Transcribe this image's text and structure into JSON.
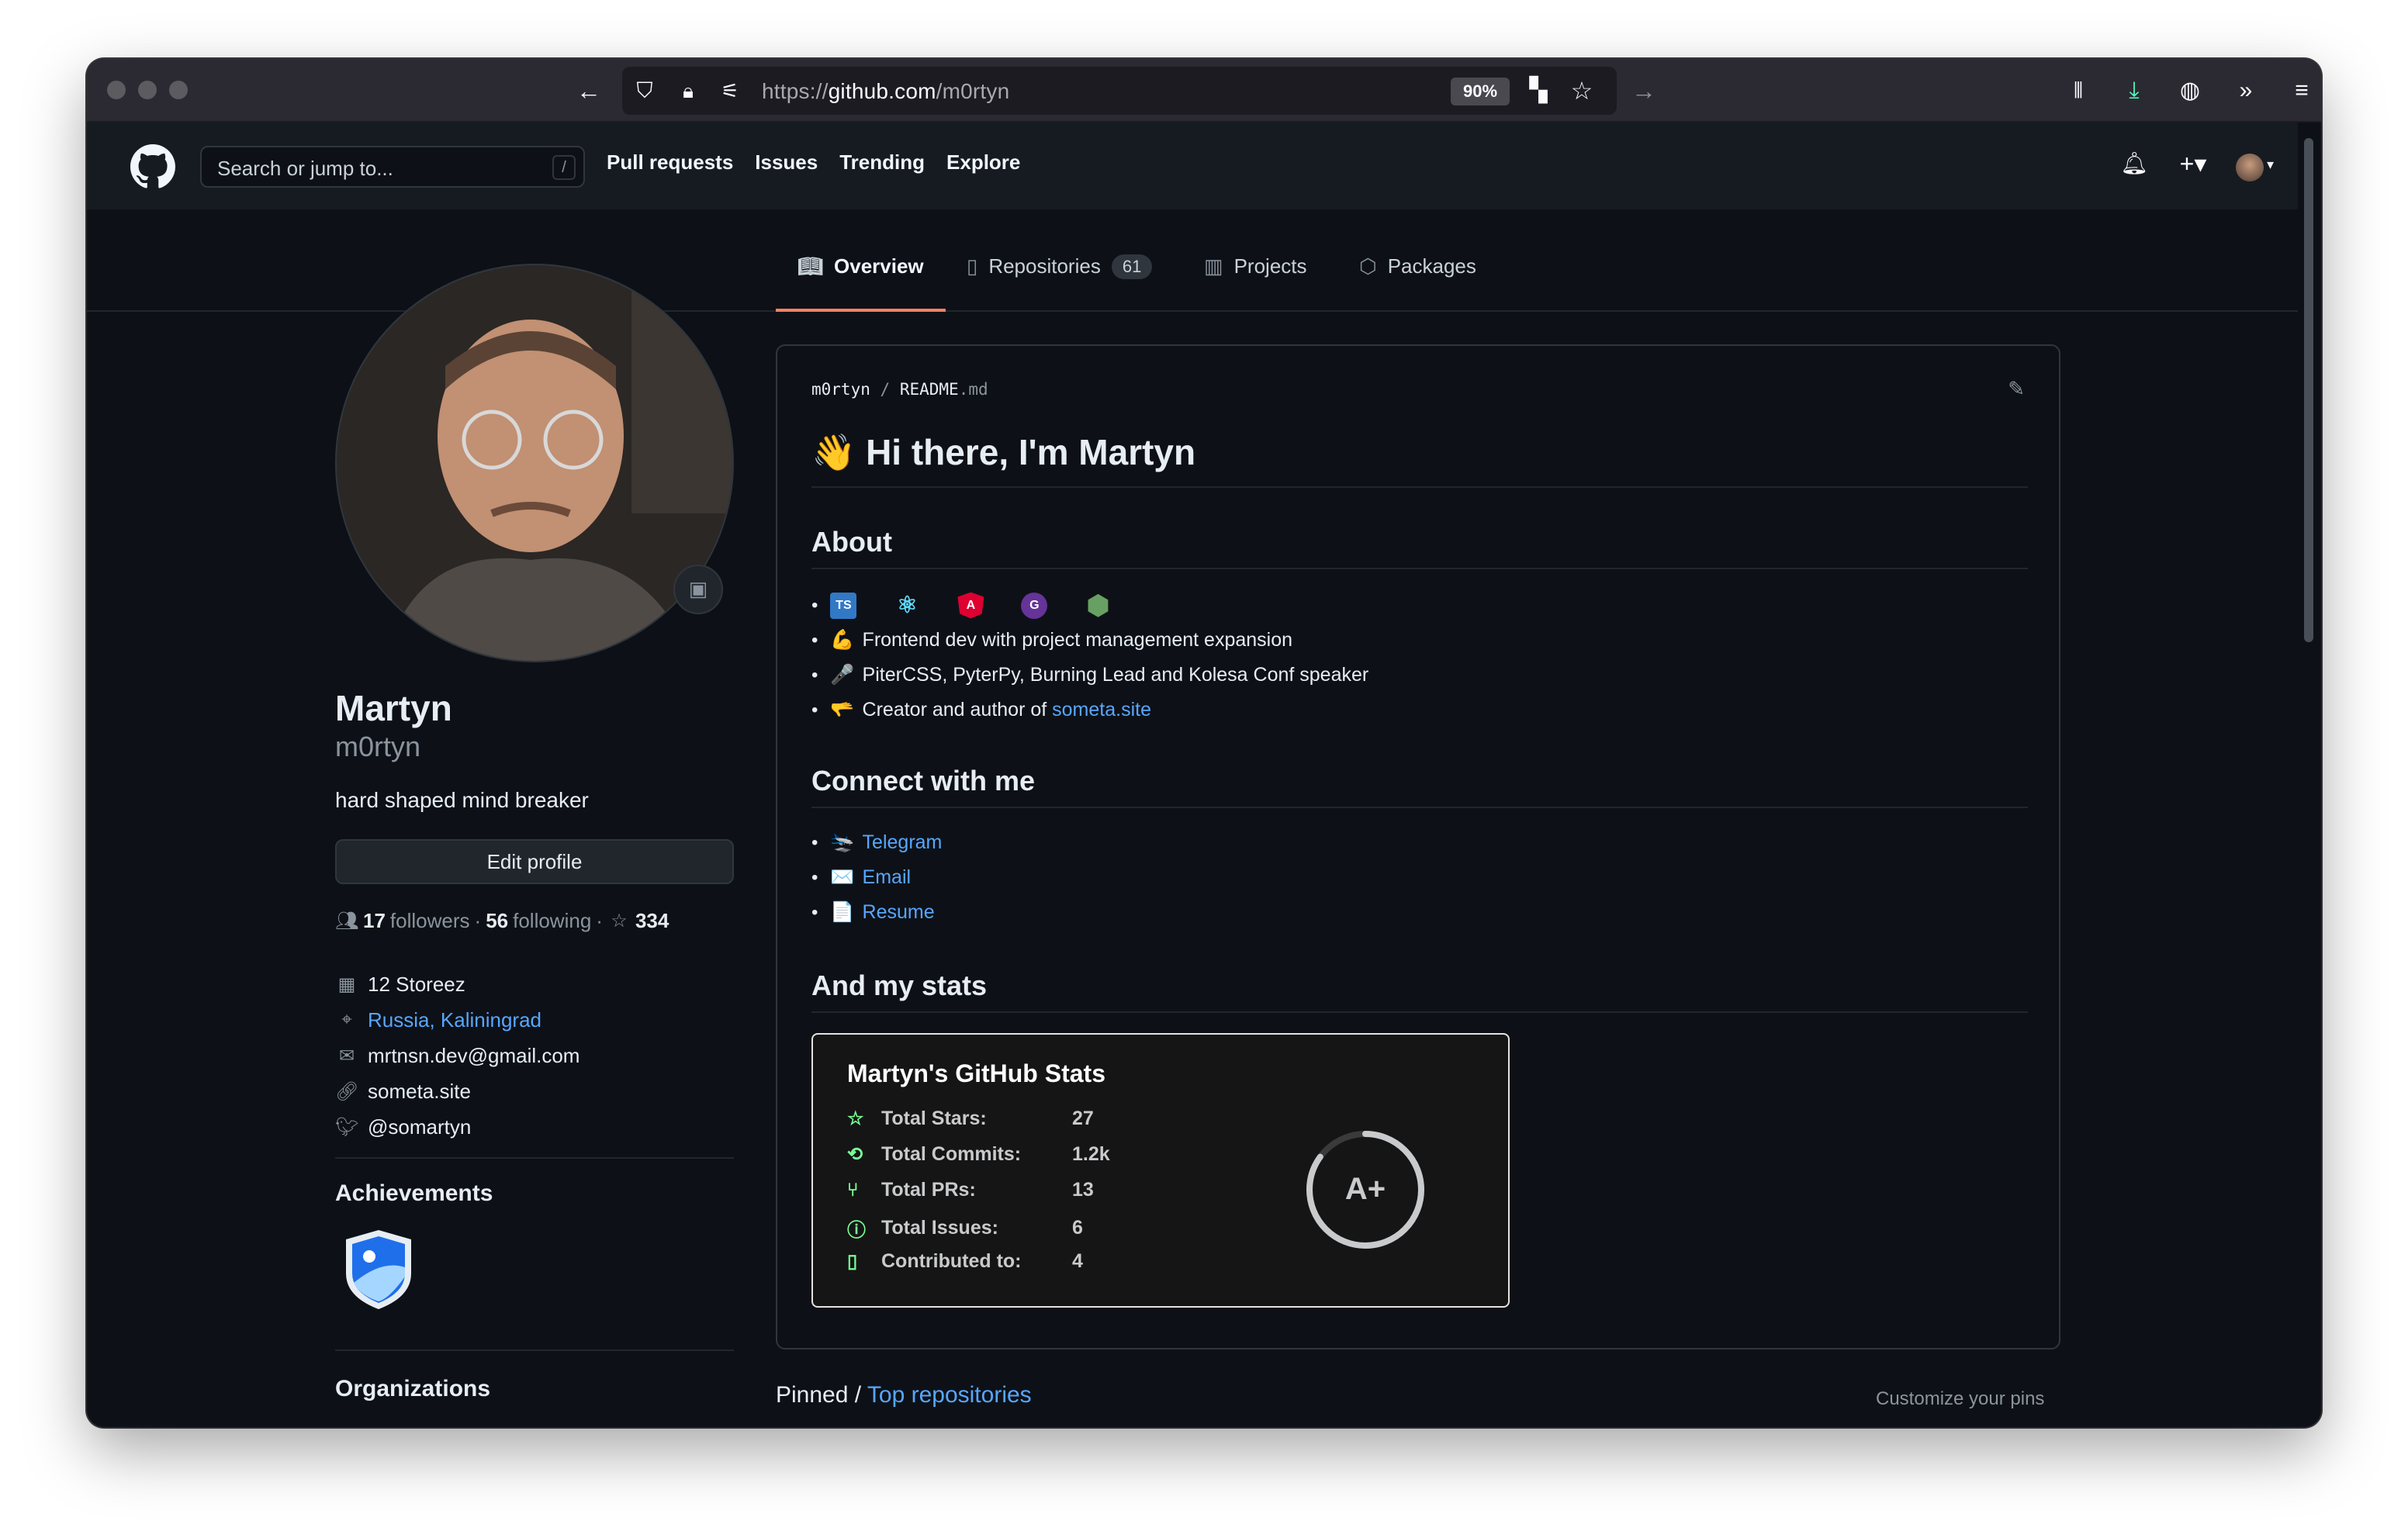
{
  "browser": {
    "url_prefix": "https://",
    "url_host": "github.com",
    "url_path": "/m0rtyn",
    "zoom": "90%"
  },
  "header": {
    "search_placeholder": "Search or jump to...",
    "search_key": "/",
    "nav": [
      "Pull requests",
      "Issues",
      "Trending",
      "Explore"
    ]
  },
  "tabs": [
    {
      "label": "Overview",
      "icon": "book-icon"
    },
    {
      "label": "Repositories",
      "icon": "repo-icon",
      "count": "61"
    },
    {
      "label": "Projects",
      "icon": "project-icon"
    },
    {
      "label": "Packages",
      "icon": "package-icon"
    }
  ],
  "profile": {
    "name": "Martyn",
    "login": "m0rtyn",
    "bio": "hard shaped mind breaker",
    "edit_label": "Edit profile",
    "followers_count": "17",
    "followers_label": "followers",
    "sep": "·",
    "following_count": "56",
    "following_label": "following",
    "stars_count": "334",
    "company": "12 Storeez",
    "location": "Russia, Kaliningrad",
    "email": "mrtnsn.dev@gmail.com",
    "website": "someta.site",
    "twitter": "@somartyn",
    "achievements_title": "Achievements",
    "organizations_title": "Organizations"
  },
  "readme": {
    "owner": "m0rtyn",
    "slash": "/",
    "file_name": "README",
    "file_ext": ".md",
    "title_emoji": "👋",
    "title": "Hi there, I'm Martyn",
    "about_title": "About",
    "tech_icons": [
      "TS",
      "⚛",
      "A",
      "G",
      "⬢"
    ],
    "about_items": [
      {
        "emoji": "💪",
        "text": "Frontend dev with project management expansion"
      },
      {
        "emoji": "🎤",
        "text": "PiterCSS, PyterPy, Burning Lead and Kolesa Conf speaker"
      },
      {
        "emoji": "🫳",
        "text": "Creator and author of ",
        "link": "someta.site"
      }
    ],
    "connect_title": "Connect with me",
    "connect_items": [
      {
        "emoji": "🛬",
        "text": "Telegram"
      },
      {
        "emoji": "✉️",
        "text": "Email"
      },
      {
        "emoji": "📄",
        "text": "Resume"
      }
    ],
    "stats_title": "And my stats"
  },
  "stats_card": {
    "title": "Martyn's GitHub Stats",
    "rows": [
      {
        "label": "Total Stars:",
        "value": "27",
        "icon": "star-icon"
      },
      {
        "label": "Total Commits:",
        "value": "1.2k",
        "icon": "history-icon"
      },
      {
        "label": "Total PRs:",
        "value": "13",
        "icon": "pr-icon"
      },
      {
        "label": "Total Issues:",
        "value": "6",
        "icon": "issue-icon"
      },
      {
        "label": "Contributed to:",
        "value": "4",
        "icon": "repo-icon"
      }
    ],
    "grade": "A+",
    "ring_color": "#c9cacc",
    "ring_fraction": 0.85,
    "accent": "#79ff97"
  },
  "pinned": {
    "label": "Pinned / ",
    "link": "Top repositories",
    "customize": "Customize your pins"
  },
  "colors": {
    "bg": "#0d1117",
    "header": "#161b22",
    "link": "#58a6ff",
    "tab_underline": "#f78166"
  }
}
